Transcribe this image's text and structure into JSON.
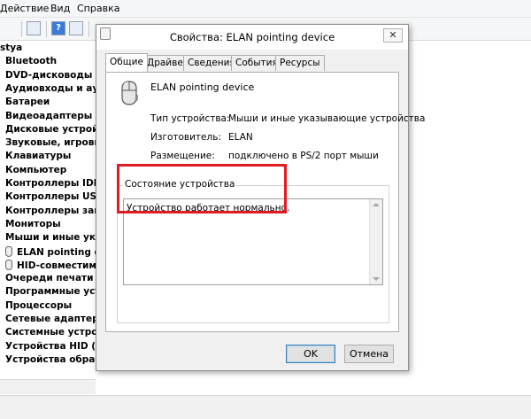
{
  "background_window": {
    "menu": [
      "Действие",
      "Вид",
      "Справка"
    ],
    "tree": {
      "root": "stya",
      "categories": [
        "Bluetooth",
        "DVD-дисководы и д",
        "Аудиовходы и аудис",
        "Батареи",
        "Видеоадаптеры",
        "Дисковые устройств",
        "Звуковые, игровые",
        "Клавиатуры",
        "Компьютер",
        "Контроллеры IDE AT",
        "Контроллеры USB",
        "Контроллеры запом",
        "Мониторы",
        "Мыши и иные указ"
      ],
      "mouse_children": [
        "ELAN pointing dev",
        "HID-совместима"
      ],
      "categories_after": [
        "Очереди печати",
        "Программные устро",
        "Процессоры",
        "Сетевые адаптеры",
        "Системные устройс",
        "Устройства HID (Hun",
        "Устройства обработ"
      ]
    }
  },
  "dialog": {
    "title": "Свойства: ELAN pointing device",
    "close_glyph": "✕",
    "tabs": [
      "Общие",
      "Драйвер",
      "Сведения",
      "События",
      "Ресурсы"
    ],
    "active_tab": "Общие",
    "device_name": "ELAN pointing device",
    "properties": [
      {
        "label": "Тип устройства:",
        "value": "Мыши и иные указывающие устройства"
      },
      {
        "label": "Изготовитель:",
        "value": "ELAN"
      },
      {
        "label": "Размещение:",
        "value": "подключено в PS/2 порт мыши"
      }
    ],
    "status_legend": "Состояние устройства",
    "status_text": "Устройство работает нормально.",
    "ok_label": "OK",
    "cancel_label": "Отмена"
  },
  "colors": {
    "highlight": "#e11b22",
    "default_button_border": "#3c7fb1"
  },
  "icons": {
    "device": "mouse-icon",
    "tree_item": "mouse-icon",
    "dialog": "device-properties-icon"
  }
}
